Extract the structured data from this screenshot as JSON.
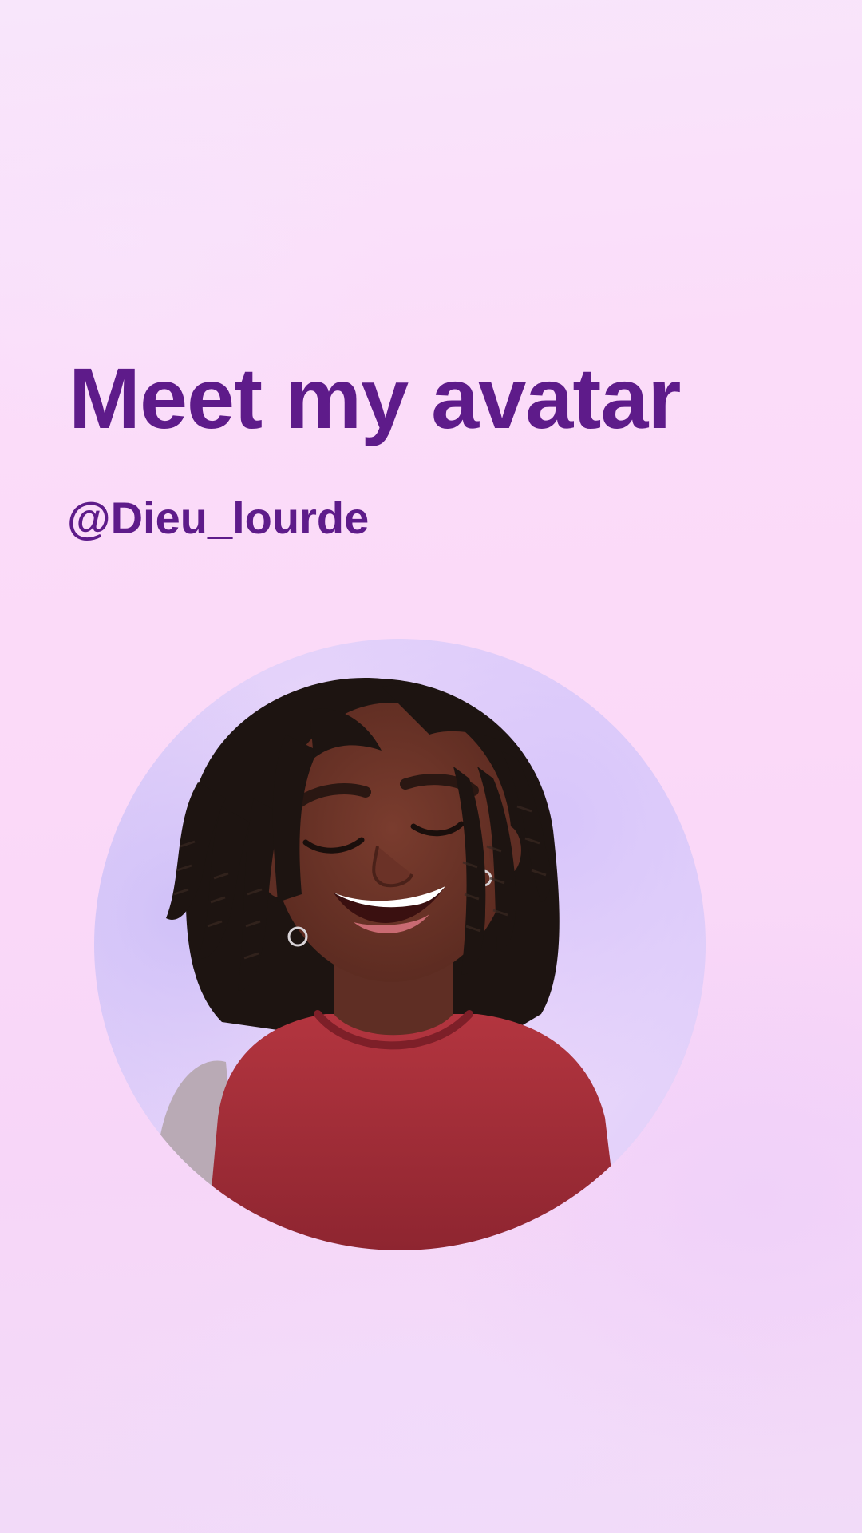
{
  "post": {
    "title": "Meet my avatar",
    "handle": "@Dieu_lourde"
  },
  "avatar": {
    "icon": "avatar-illustration",
    "shirt_color": "#a42d3a",
    "skin_color": "#6a3328",
    "hair_color": "#1d1411",
    "background_color": "#e4d2f9"
  },
  "theme": {
    "accent": "#5e1b8a",
    "background": "#fbdcf9"
  }
}
